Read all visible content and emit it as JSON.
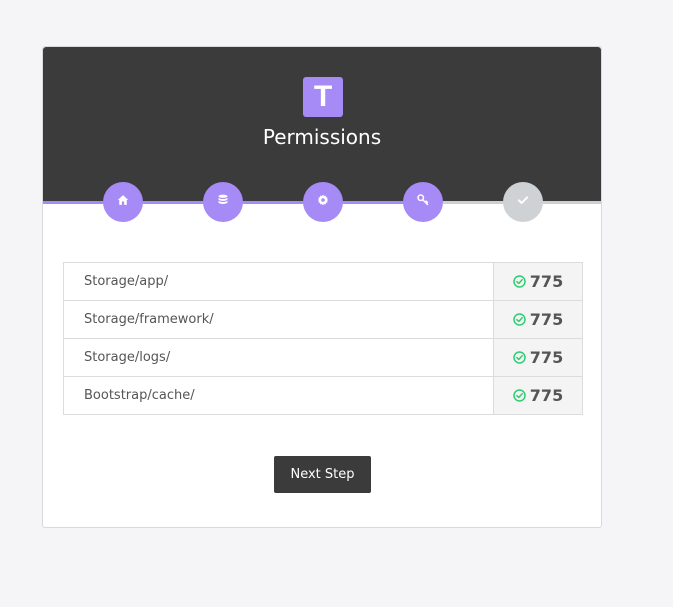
{
  "header": {
    "logo_letter": "T",
    "title": "Permissions"
  },
  "steps": [
    {
      "icon": "home-icon",
      "state": "complete"
    },
    {
      "icon": "database-icon",
      "state": "complete"
    },
    {
      "icon": "gear-icon",
      "state": "complete"
    },
    {
      "icon": "key-icon",
      "state": "complete"
    },
    {
      "icon": "check-icon",
      "state": "incomplete"
    }
  ],
  "progress": {
    "completed_fraction": 0.71
  },
  "permissions": [
    {
      "path": "Storage/app/",
      "value": "775",
      "status": "ok"
    },
    {
      "path": "Storage/framework/",
      "value": "775",
      "status": "ok"
    },
    {
      "path": "Storage/logs/",
      "value": "775",
      "status": "ok"
    },
    {
      "path": "Bootstrap/cache/",
      "value": "775",
      "status": "ok"
    }
  ],
  "actions": {
    "next_label": "Next Step"
  },
  "colors": {
    "accent": "#a68af5",
    "header_bg": "#3b3b3b",
    "ok": "#2ecc71",
    "inactive_step": "#cfd2d4"
  }
}
